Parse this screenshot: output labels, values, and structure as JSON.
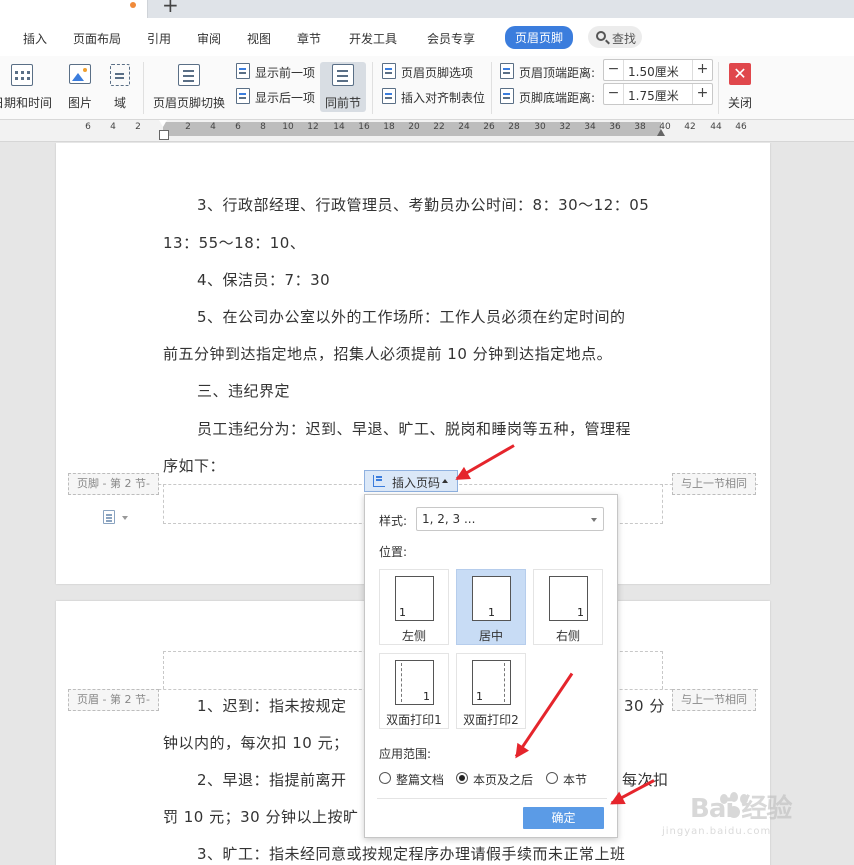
{
  "menu": {
    "items": [
      "插入",
      "页面布局",
      "引用",
      "审阅",
      "视图",
      "章节",
      "开发工具",
      "会员专享"
    ],
    "active": "页眉页脚",
    "search": "查找"
  },
  "ribbon": {
    "date_time": "日期和时间",
    "picture": "图片",
    "field": "域",
    "hf_switch": "页眉页脚切换",
    "show_prev": "显示前一项",
    "show_next": "显示后一项",
    "same_as_prev": "同前节",
    "hf_options": "页眉页脚选项",
    "insert_align_tab": "插入对齐制表位",
    "header_top_label": "页眉顶端距离:",
    "header_top_value": "1.50厘米",
    "footer_bottom_label": "页脚底端距离:",
    "footer_bottom_value": "1.75厘米",
    "close": "关闭"
  },
  "ruler": {
    "numbers": [
      "6",
      "4",
      "2",
      "2",
      "4",
      "6",
      "8",
      "10",
      "12",
      "14",
      "16",
      "18",
      "20",
      "22",
      "24",
      "26",
      "28",
      "30",
      "32",
      "34",
      "36",
      "38",
      "40",
      "42",
      "44",
      "46"
    ]
  },
  "page1": {
    "lines": [
      "3、行政部经理、行政管理员、考勤员办公时间：8：30～12：05",
      "13：55～18：10、",
      "4、保洁员：7：30",
      "5、在公司办公室以外的工作场所：工作人员必须在约定时间的",
      "前五分钟到达指定地点，招集人必须提前 10 分钟到达指定地点。",
      "三、违纪界定",
      "员工违纪分为：迟到、早退、旷工、脱岗和睡岗等五种，管理程",
      "序如下："
    ],
    "footer_tag": "页脚 - 第 2 节-",
    "same_as_prev_tag": "与上一节相同"
  },
  "page2": {
    "header_tag": "页眉 - 第 2 节-",
    "same_as_prev_tag": "与上一节相同",
    "lines": [
      "1、迟到：指未按规定",
      "30 分",
      "钟以内的，每次扣 10 元；",
      "2、早退：指提前离开",
      "每次扣",
      "罚 10 元；30 分钟以上按旷",
      "3、旷工：指未经同意或按规定程序办理请假手续而未正常上班"
    ]
  },
  "insert_page_number": {
    "button_label": "插入页码",
    "style_label": "样式:",
    "style_value": "1, 2, 3 ...",
    "position_label": "位置:",
    "positions": [
      {
        "label": "左侧",
        "num": "1",
        "selected": false
      },
      {
        "label": "居中",
        "num": "1",
        "selected": true
      },
      {
        "label": "右侧",
        "num": "1",
        "selected": false
      },
      {
        "label": "双面打印1",
        "num": "1",
        "selected": false
      },
      {
        "label": "双面打印2",
        "num": "1",
        "selected": false
      }
    ],
    "scope_label": "应用范围:",
    "scope_options": [
      {
        "label": "整篇文档",
        "checked": false
      },
      {
        "label": "本页及之后",
        "checked": true
      },
      {
        "label": "本节",
        "checked": false
      }
    ],
    "ok": "确定"
  },
  "watermark": {
    "brand": "Bai  经验",
    "url": "jingyan.baidu.com"
  },
  "colors": {
    "accent": "#3b7ddd",
    "annotation_arrow": "#e5252c",
    "ok_button": "#5b9be6",
    "selected_card": "#c8dcf5",
    "close_button": "#e0474c"
  }
}
